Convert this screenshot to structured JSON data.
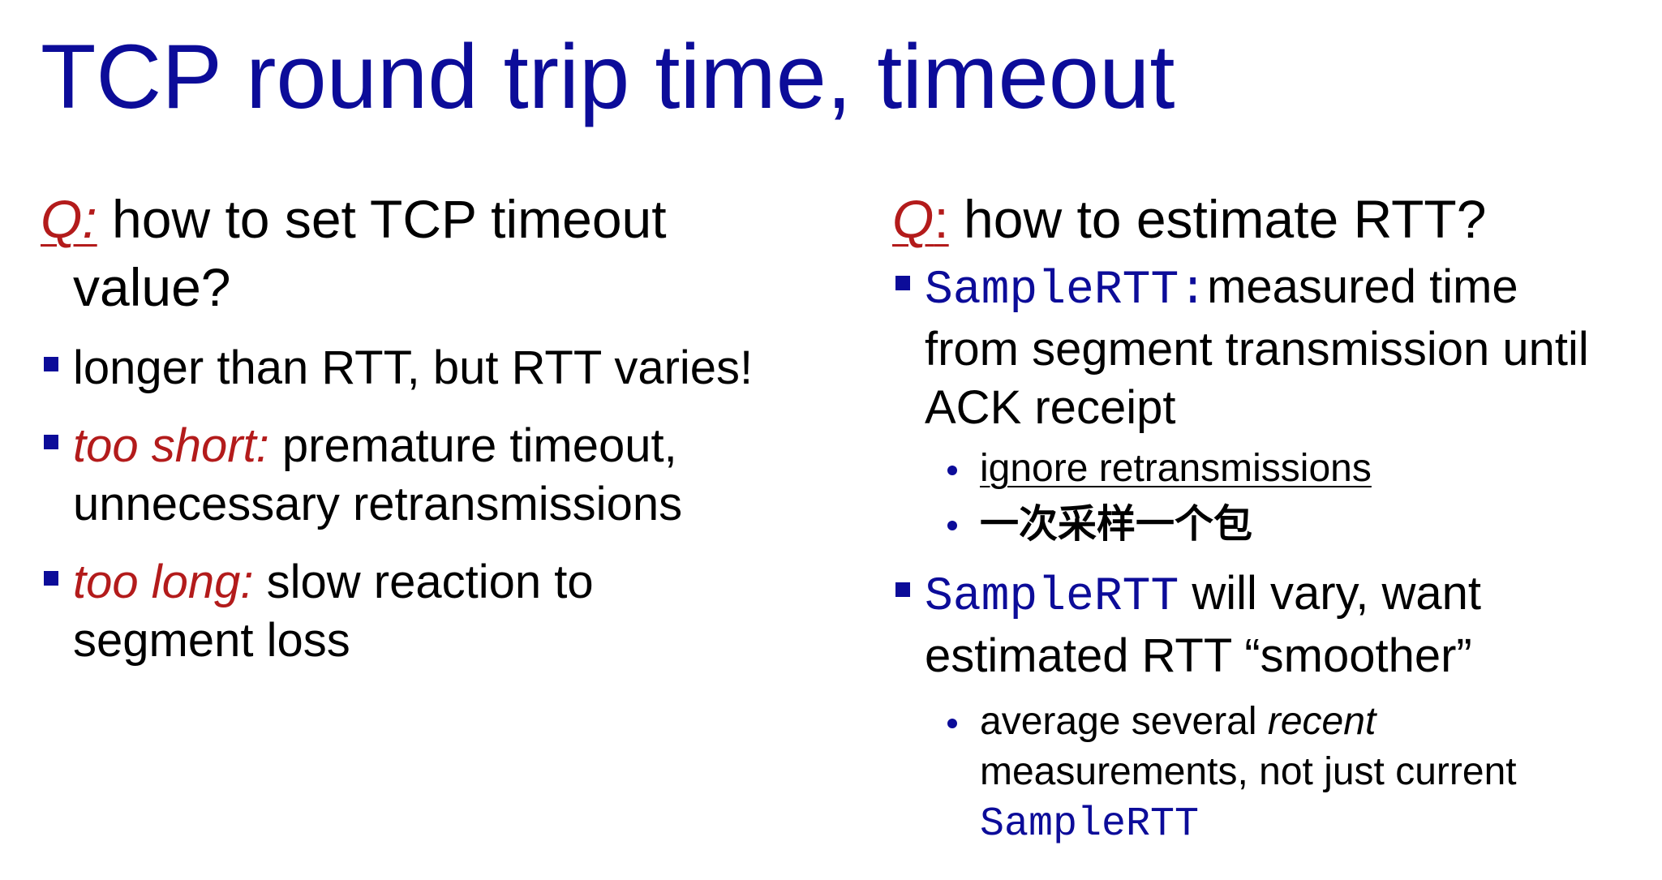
{
  "title": "TCP round trip time, timeout",
  "left": {
    "q_mark": "Q:",
    "q_text": "how to set TCP timeout",
    "q_cont": "value?",
    "bullets": [
      {
        "text": "longer than RTT, but RTT varies!"
      },
      {
        "emph": "too short:",
        "text": " premature timeout,",
        "cont": "unnecessary retransmissions"
      },
      {
        "emph": "too long:",
        "text": " slow reaction to",
        "cont": "segment loss"
      }
    ]
  },
  "right": {
    "q_mark": "Q",
    "q_colon": ":",
    "q_text": "how to estimate RTT?",
    "bullets": [
      {
        "code": "SampleRTT:",
        "text": "measured time",
        "cont1": "from segment transmission until",
        "cont2": "ACK receipt",
        "subs": [
          {
            "text": "ignore retransmissions"
          },
          {
            "text": "一次采样一个包"
          }
        ]
      },
      {
        "code": "SampleRTT",
        "text": " will vary, want",
        "cont1": "estimated RTT “smoother”",
        "subs": [
          {
            "pre": "average several ",
            "emph": "recent",
            "line2": "measurements, not just current",
            "code": "SampleRTT"
          }
        ]
      }
    ]
  },
  "colors": {
    "title": "#0c0c99",
    "accent_red": "#b31b1b",
    "bullet_blue": "#0c0c99"
  }
}
